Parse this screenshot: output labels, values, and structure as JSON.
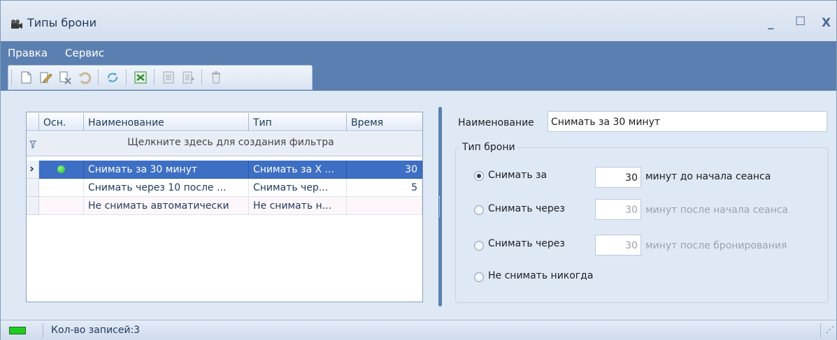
{
  "window": {
    "title": "Типы брони",
    "icon": "cinema-camera-icon",
    "controls": [
      "_",
      "☐",
      "X"
    ]
  },
  "menu": [
    "Правка",
    "Сервис"
  ],
  "toolbar": {
    "icons": [
      "new-document-icon",
      "edit-icon",
      "delete-icon",
      "undo-icon",
      "refresh-icon",
      "excel-export-icon",
      "move-up-icon",
      "move-down-icon",
      "trash-icon"
    ]
  },
  "grid": {
    "columns": [
      "Осн.",
      "Наименование",
      "Тип",
      "Время"
    ],
    "filter_hint": "Щелкните здесь для создания фильтра",
    "rows": [
      {
        "main": true,
        "name": "Снимать за 30 минут",
        "type": "Снимать за X ...",
        "time": "30",
        "selected": true
      },
      {
        "main": false,
        "name": "Снимать через 10 после ...",
        "type": "Снимать чер...",
        "time": "5",
        "selected": false
      },
      {
        "main": false,
        "name": "Не снимать автоматически",
        "type": "Не снимать н...",
        "time": "",
        "selected": false
      }
    ]
  },
  "form": {
    "name_label": "Наименование",
    "name_value": "Снимать за 30 минут",
    "group_title": "Тип брони",
    "options": [
      {
        "label": "Снимать за",
        "value": "30",
        "suffix": "минут до начала сеанса",
        "checked": true,
        "enabled": true
      },
      {
        "label": "Снимать через",
        "value": "30",
        "suffix": "минут после начала сеанса",
        "checked": false,
        "enabled": false
      },
      {
        "label": "Снимать через",
        "value": "30",
        "suffix": "минут после бронирования",
        "checked": false,
        "enabled": false
      },
      {
        "label": "Не снимать никогда",
        "checked": false
      }
    ]
  },
  "status": {
    "text": "Кол-во записей:3"
  },
  "colors": {
    "accent": "#5b7fb0",
    "selection": "#3d6fc4",
    "status_indicator": "#22cc22"
  }
}
